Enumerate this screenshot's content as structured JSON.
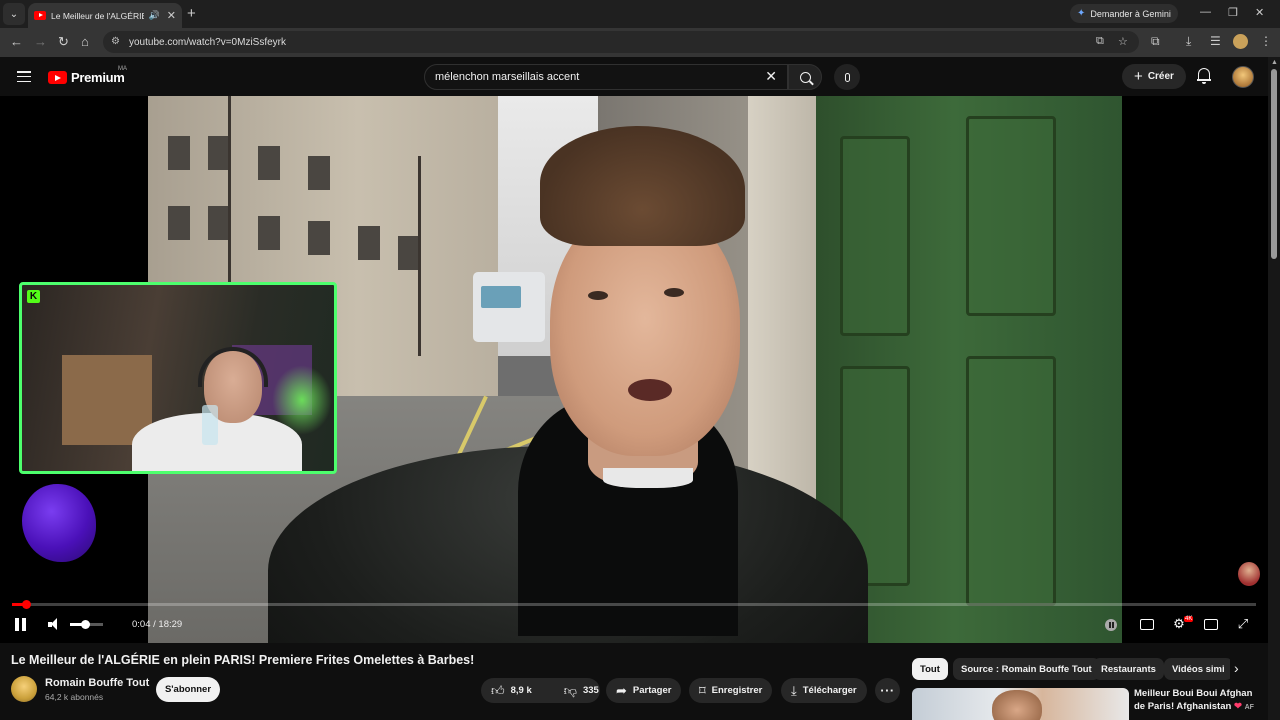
{
  "browser": {
    "tab_title": "Le Meilleur de l'ALGÉRIE en plein PARIS! Premiere Frites Omelettes à Barbes!",
    "url": "youtube.com/watch?v=0MziSsfeyrk",
    "gemini_label": "Demander à Gemini"
  },
  "masthead": {
    "logo_text": "Premium",
    "country_code": "MA",
    "search_query": "mélenchon marseillais accent",
    "create_label": "Créer"
  },
  "player": {
    "time_current": "0:04",
    "time_separator": " / ",
    "time_total": "18:29",
    "progress_fraction": 0.004,
    "volume_fraction": 0.45,
    "quality_badge": "4K",
    "webcam_logo": "K"
  },
  "video": {
    "title": "Le Meilleur de l'ALGÉRIE en plein PARIS! Premiere Frites Omelettes à Barbes!",
    "channel_name": "Romain Bouffe Tout",
    "subscribers": "64,2 k abonnés",
    "subscribe_label": "S'abonner",
    "likes": "8,9 k",
    "dislikes": "335",
    "share_label": "Partager",
    "save_label": "Enregistrer",
    "download_label": "Télécharger"
  },
  "sidebar": {
    "chips": [
      "Tout",
      "Source : Romain Bouffe Tout",
      "Restaurants",
      "Vidéos simi"
    ],
    "recommendation": {
      "title": "Meilleur Boui Boui Afghan de Paris! Afghanistan",
      "tag": "AF"
    }
  },
  "colors": {
    "accent": "#ff0000",
    "background": "#0f0f0f",
    "webcam_border": "#4dff6d"
  }
}
